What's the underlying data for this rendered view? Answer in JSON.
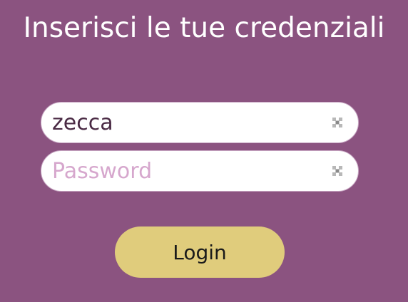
{
  "page": {
    "title": "Inserisci le tue credenziali"
  },
  "form": {
    "username": {
      "value": "zecca",
      "placeholder": ""
    },
    "password": {
      "value": "",
      "placeholder": "Password"
    },
    "login_label": "Login"
  },
  "icons": {
    "clear": "clear-icon"
  },
  "colors": {
    "background": "#8b5380",
    "button": "#e0cc7c",
    "placeholder": "#d6a7cd"
  }
}
